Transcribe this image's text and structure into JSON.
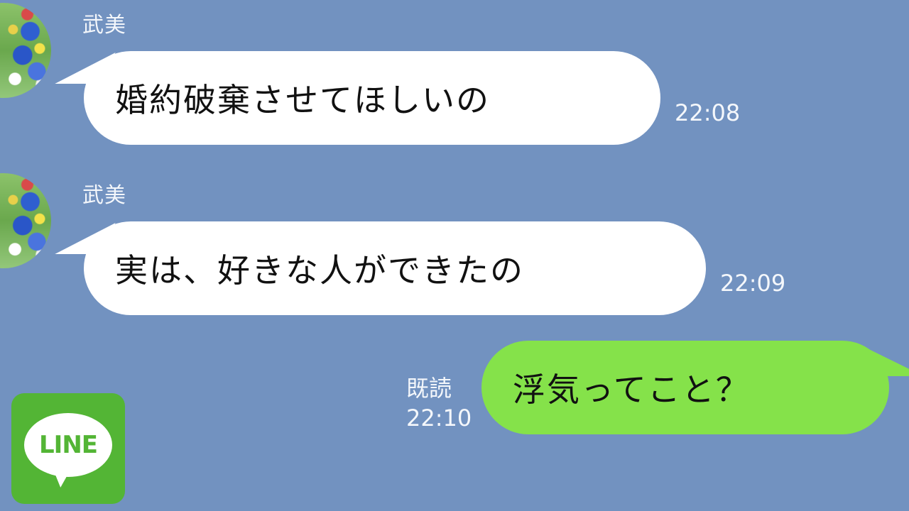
{
  "messages": [
    {
      "sender": "武美",
      "text": "婚約破棄させてほしいの",
      "time": "22:08",
      "avatar_icon": "flower-field-avatar"
    },
    {
      "sender": "武美",
      "text": "実は、好きな人ができたの",
      "time": "22:09",
      "avatar_icon": "flower-field-avatar"
    },
    {
      "sender": "self",
      "text": "浮気ってこと？",
      "read_label": "既読",
      "time": "22:10"
    }
  ],
  "logo": {
    "text": "LINE",
    "icon": "line-app-icon"
  },
  "colors": {
    "background": "#7292c0",
    "incoming_bubble": "#ffffff",
    "outgoing_bubble": "#85e24a",
    "logo_green": "#53b535",
    "meta_text": "#f4f7fb"
  }
}
